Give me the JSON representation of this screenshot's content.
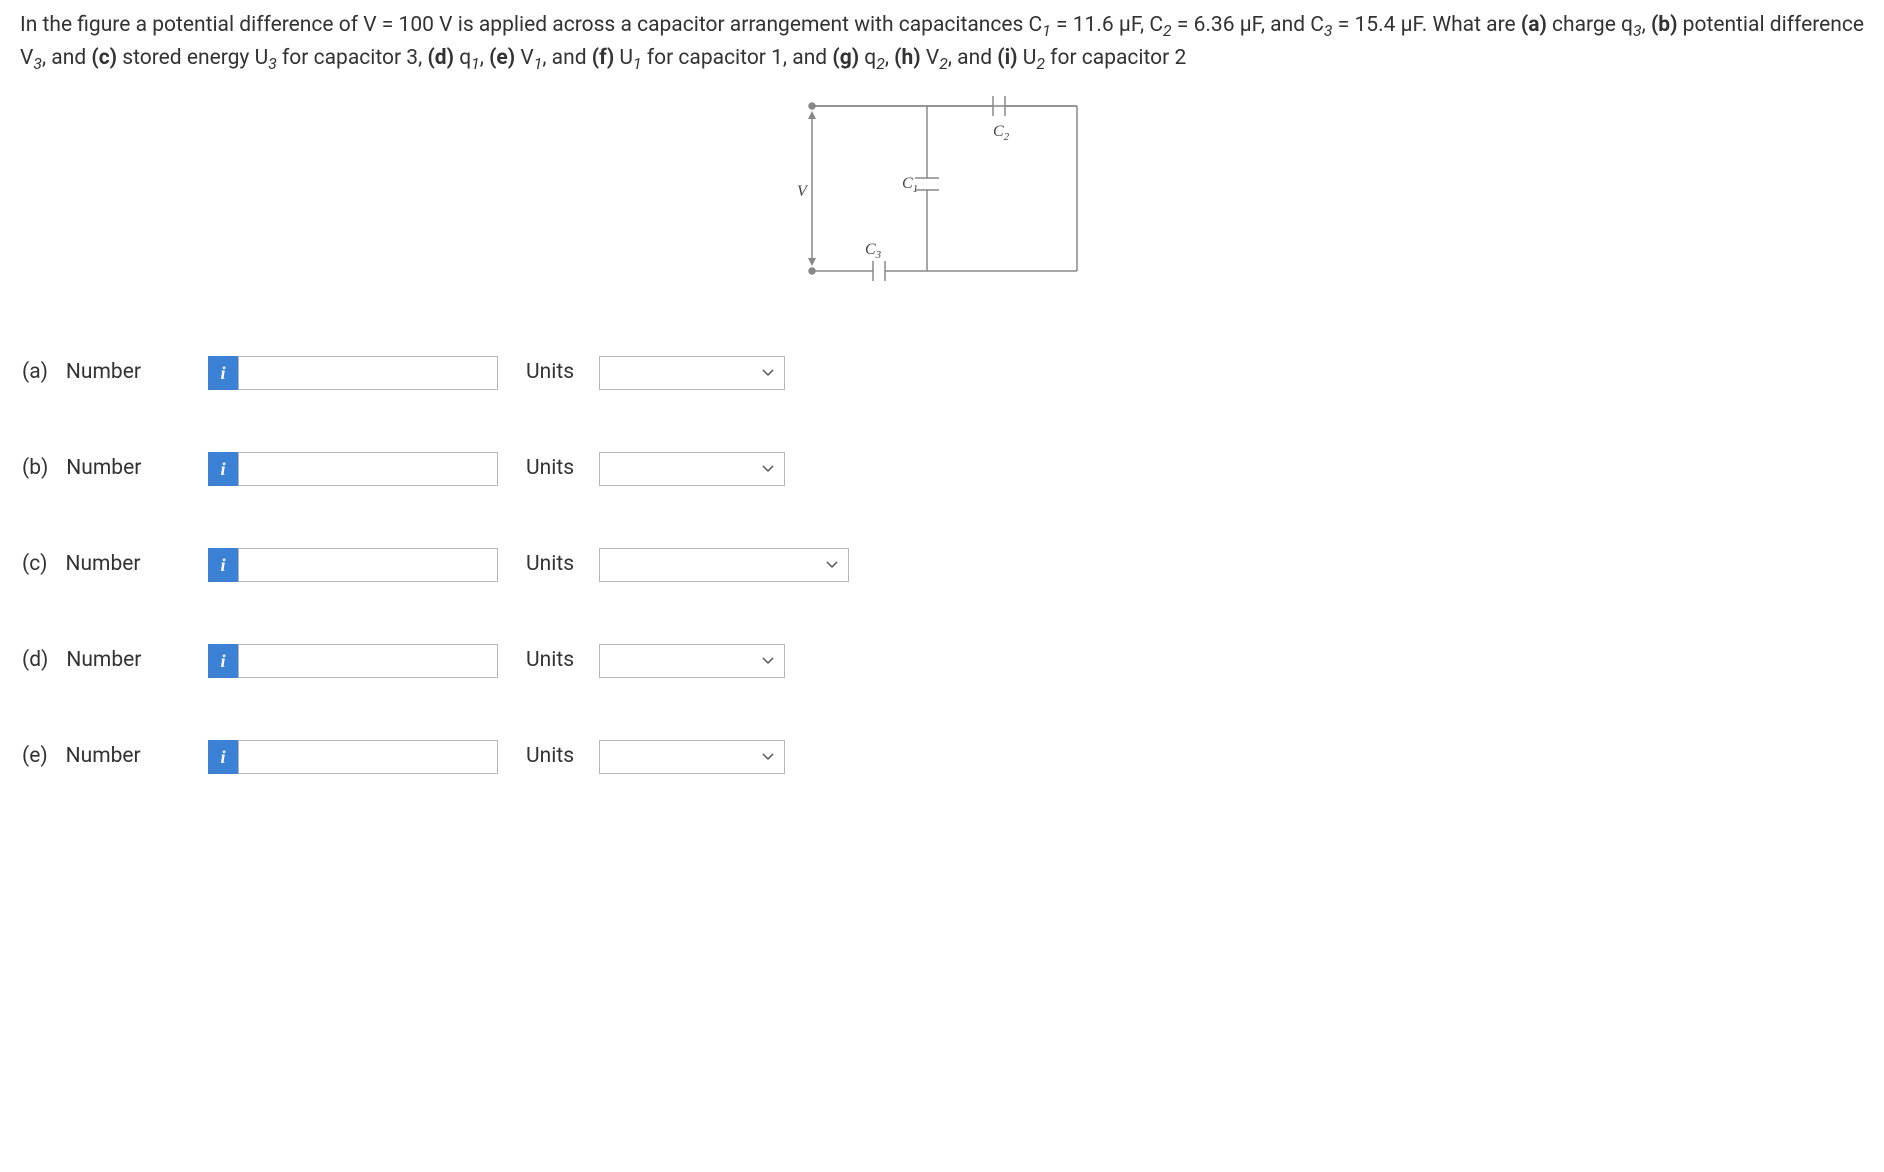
{
  "question": {
    "p1_prefix": "In the figure a potential difference of V = 100 V is applied across a capacitor arrangement with capacitances C",
    "sub1": "1",
    "p1_c1val": " = 11.6 µF, C",
    "sub2": "2",
    "p1_c2val": " = 6.36 µF, and C",
    "sub3": "3",
    "p1_c3val": " = 15.4 µF. What are ",
    "a_label": "(a)",
    "a_text": " charge q",
    "a_sub": "3",
    "a_suffix": ", ",
    "b_label": "(b)",
    "b_text": " potential difference V",
    "b_sub": "3",
    "b_suffix": ", and ",
    "c_label": "(c)",
    "c_text": " stored energy U",
    "c_sub": "3",
    "c_suffix": " for capacitor 3, ",
    "d_label": "(d)",
    "d_text": " q",
    "d_sub": "1",
    "d_suffix": ", ",
    "e_label": "(e)",
    "e_text": " V",
    "e_sub": "1",
    "e_suffix": ", and ",
    "f_label": "(f)",
    "f_text": " U",
    "f_sub": "1",
    "f_suffix": " for capacitor 1, and ",
    "g_label": "(g)",
    "g_text": " q",
    "g_sub": "2",
    "g_suffix": ", ",
    "h_label": "(h)",
    "h_text": " V",
    "h_sub": "2",
    "h_suffix": ", and ",
    "i_label": "(i)",
    "i_text": " U",
    "i_sub": "2",
    "i_suffix": " for capacitor 2"
  },
  "figure": {
    "labels": {
      "V": "V",
      "C1": "C",
      "C1sub": "1",
      "C2": "C",
      "C2sub": "2",
      "C3": "C",
      "C3sub": "3"
    }
  },
  "rows": {
    "a": {
      "letter": "(a)",
      "label": "Number",
      "units_label": "Units",
      "info": "i",
      "wide": false
    },
    "b": {
      "letter": "(b)",
      "label": "Number",
      "units_label": "Units",
      "info": "i",
      "wide": false
    },
    "c": {
      "letter": "(c)",
      "label": "Number",
      "units_label": "Units",
      "info": "i",
      "wide": true
    },
    "d": {
      "letter": "(d)",
      "label": "Number",
      "units_label": "Units",
      "info": "i",
      "wide": false
    },
    "e": {
      "letter": "(e)",
      "label": "Number",
      "units_label": "Units",
      "info": "i",
      "wide": false
    }
  }
}
